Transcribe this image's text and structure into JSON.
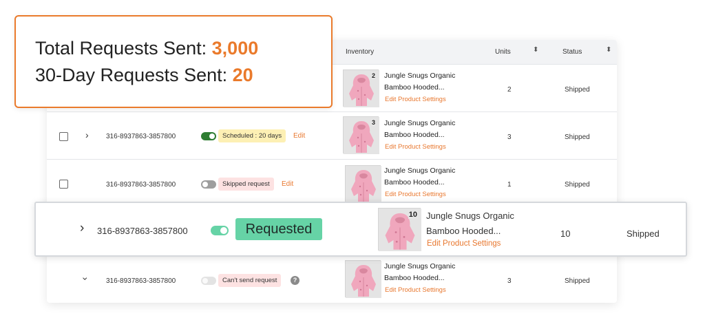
{
  "stats": {
    "total_label": "Total Requests Sent: ",
    "total_value": "3,000",
    "thirty_day_label": "30-Day Requests Sent: ",
    "thirty_day_value": "20",
    "accent_color": "#ea7a2b"
  },
  "table": {
    "headers": {
      "inventory": "Inventory",
      "units": "Units",
      "status": "Status"
    },
    "rows": [
      {
        "order_id": "",
        "request_status": "",
        "thumb_badge": "2",
        "product_line1": "Jungle Snugs Organic",
        "product_line2": "Bamboo Hooded...",
        "product_link": "Edit Product Settings",
        "units": "2",
        "status": "Shipped"
      },
      {
        "order_id": "316-8937863-3857800",
        "request_status": "Scheduled : 20 days",
        "edit": "Edit",
        "toggle": "on",
        "thumb_badge": "3",
        "product_line1": "Jungle Snugs Organic",
        "product_line2": "Bamboo Hooded...",
        "product_link": "Edit Product Settings",
        "units": "3",
        "status": "Shipped"
      },
      {
        "order_id": "316-8937863-3857800",
        "request_status": "Skipped request",
        "edit": "Edit",
        "toggle": "off",
        "thumb_badge": "",
        "product_line1": "Jungle Snugs Organic",
        "product_line2": "Bamboo Hooded...",
        "product_link": "Edit Product Settings",
        "units": "1",
        "status": "Shipped"
      },
      {
        "order_id": "316-8937863-3857800",
        "request_status": "Can't send request",
        "help": "?",
        "toggle": "disabled",
        "thumb_badge": "",
        "product_line1": "Jungle Snugs Organic",
        "product_line2": "Bamboo Hooded...",
        "product_link": "Edit Product Settings",
        "units": "3",
        "status": "Shipped"
      }
    ]
  },
  "highlight_row": {
    "order_id": "316-8937863-3857800",
    "request_status": "Requested",
    "thumb_badge": "10",
    "product_line1": "Jungle Snugs Organic",
    "product_line2": "Bamboo Hooded...",
    "product_link": "Edit Product Settings",
    "units": "10",
    "status": "Shipped",
    "status_color": "#66d3a6"
  },
  "icons": {
    "expand": "chevron-right-icon",
    "collapse": "chevron-down-icon",
    "sort": "sort-icon",
    "help": "help-icon"
  }
}
